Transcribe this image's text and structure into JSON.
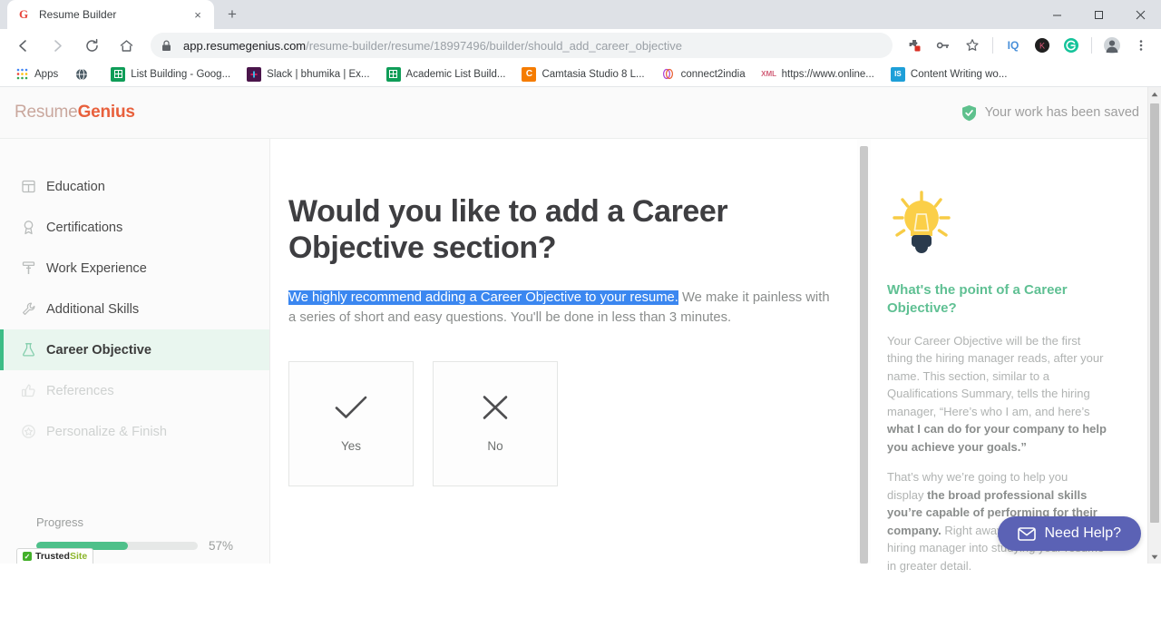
{
  "browser": {
    "tab": {
      "title": "Resume Builder",
      "favicon": "google-g-icon",
      "close": "×"
    },
    "new_tab_label": "+",
    "window_controls": {
      "minimize": "—",
      "maximize": "❐",
      "close": "✕"
    },
    "nav": {
      "back": "←",
      "forward": "→",
      "reload": "↻",
      "home": "⌂"
    },
    "omnibox": {
      "lock": "lock-icon",
      "url_domain": "app.resumegenius.com",
      "url_path": "/resume-builder/resume/18997496/builder/should_add_career_objective"
    },
    "toolbar_icons": [
      {
        "name": "extension-puzzle-icon",
        "glyph": "⚙"
      },
      {
        "name": "password-key-icon",
        "glyph": "⚷"
      },
      {
        "name": "bookmark-star-icon",
        "glyph": "☆"
      },
      {
        "name": "grammarly-iq-icon",
        "glyph": "IQ"
      },
      {
        "name": "extension-k-icon",
        "glyph": "K"
      },
      {
        "name": "grammarly-g-icon",
        "glyph": "G"
      },
      {
        "name": "profile-avatar-icon",
        "glyph": "●"
      },
      {
        "name": "chrome-menu-icon",
        "glyph": "⋮"
      }
    ],
    "bookmarks": [
      {
        "label": "Apps",
        "icon": "apps-grid-icon",
        "icon_char": "∷",
        "color": "#4285f4"
      },
      {
        "label": "",
        "icon": "globe-icon",
        "icon_char": "◔",
        "color": "#5f6368"
      },
      {
        "label": "List Building - Goog...",
        "icon": "google-sheets-icon",
        "icon_char": "⌸",
        "color": "#0f9d58"
      },
      {
        "label": "Slack | bhumika | Ex...",
        "icon": "slack-icon",
        "icon_char": "✦",
        "color": "#4a154b"
      },
      {
        "label": "Academic List Build...",
        "icon": "google-sheets-icon",
        "icon_char": "⌸",
        "color": "#0f9d58"
      },
      {
        "label": "Camtasia Studio 8 L...",
        "icon": "camtasia-icon",
        "icon_char": "C",
        "color": "#f57c00"
      },
      {
        "label": "connect2india",
        "icon": "connect2india-icon",
        "icon_char": "∞",
        "color": "#b04ad6"
      },
      {
        "label": "https://www.online...",
        "icon": "xml-icon",
        "icon_char": "x",
        "color": "#d2617a"
      },
      {
        "label": "Content Writing wo...",
        "icon": "is-icon",
        "icon_char": "IS",
        "color": "#1e9fd8"
      }
    ]
  },
  "app": {
    "logo": {
      "part1": "Resume",
      "part2": "Genius"
    },
    "saved_status": {
      "icon": "shield-check-icon",
      "text": "Your work has been saved"
    },
    "sidebar": {
      "items": [
        {
          "label": "Education",
          "icon": "book-icon",
          "state": "default"
        },
        {
          "label": "Certifications",
          "icon": "award-ribbon-icon",
          "state": "default"
        },
        {
          "label": "Work Experience",
          "icon": "hammer-icon",
          "state": "default"
        },
        {
          "label": "Additional Skills",
          "icon": "wrench-icon",
          "state": "default"
        },
        {
          "label": "Career Objective",
          "icon": "flask-icon",
          "state": "active"
        },
        {
          "label": "References",
          "icon": "thumbs-up-icon",
          "state": "disabled"
        },
        {
          "label": "Personalize & Finish",
          "icon": "star-badge-icon",
          "state": "disabled"
        }
      ],
      "progress": {
        "label": "Progress",
        "percent_label": "57%",
        "percent_value": 57,
        "fill_color": "#4ec08a"
      },
      "trustedsite": {
        "part1": "Trusted",
        "part2": "Site",
        "check": "✓"
      }
    },
    "main": {
      "heading": "Would you like to add a Career Objective section?",
      "lede_highlighted": "We highly recommend adding a Career Objective to your resume.",
      "lede_rest": " We make it painless with a series of short and easy questions. You'll be done in less than 3 minutes.",
      "selection_color": "#3b87f0",
      "choices": [
        {
          "label": "Yes",
          "icon": "check-icon"
        },
        {
          "label": "No",
          "icon": "cross-icon"
        }
      ]
    },
    "rail": {
      "icon": "lightbulb-icon",
      "heading": "What's the point of a Career Objective?",
      "p1_a": "Your Career Objective will be the first thing the hiring manager reads, after your name. This section, similar to a Qualifications Summary, tells the hiring manager, “Here’s who I am, and here’s ",
      "p1_b": "what I can do for your company to help you achieve your goals.”",
      "p2_a": "That’s why we’re going to help you display ",
      "p2_b": "the broad professional skills you’re capable of performing for their company.",
      "p2_c": " Right away, you’ll hook the hiring manager into studying your resume in greater detail."
    },
    "need_help": {
      "label": "Need Help?",
      "icon": "envelope-icon",
      "color": "#5b62b5"
    }
  }
}
